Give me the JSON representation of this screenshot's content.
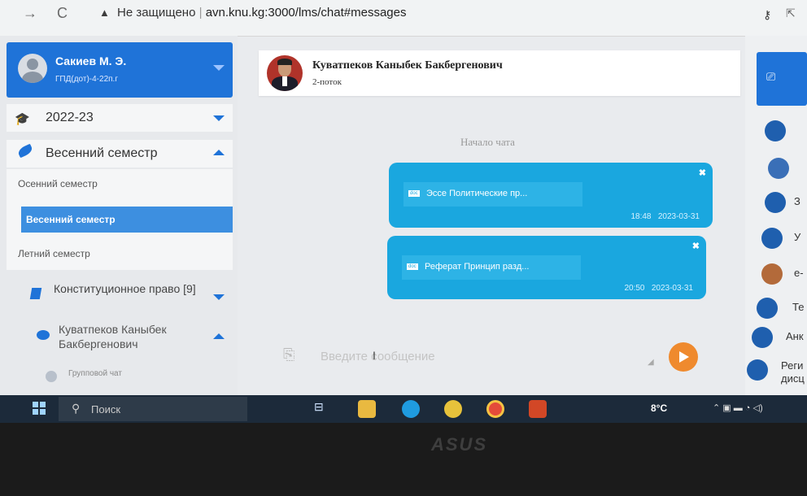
{
  "browser": {
    "security_label": "Не защищено",
    "separator": "|",
    "url": "avn.knu.kg:3000/lms/chat#messages"
  },
  "user": {
    "name": "Сакиев М. Э.",
    "group": "ГПД(дот)-4-22п.г"
  },
  "academic_year": "2022-23",
  "semester": {
    "selected": "Весенний семестр",
    "options": [
      "Осенний семестр",
      "Весенний семестр",
      "Летний семестр"
    ]
  },
  "course": {
    "label": "Конституционное право [9]"
  },
  "chat_contact": {
    "label": "Куватпеков Каныбек Бакбергенович"
  },
  "group_chat": {
    "label": "Групповой чат"
  },
  "chat": {
    "header_name": "Куватпеков Каныбек Бакбергенович",
    "header_stream": "2-поток",
    "start_label": "Начало чата",
    "messages": [
      {
        "file_type": "doc",
        "file_name": "Эссе Политические пр...",
        "time": "18:48",
        "date": "2023-03-31"
      },
      {
        "file_type": "doc",
        "file_name": "Реферат Принцип разд...",
        "time": "20:50",
        "date": "2023-03-31"
      }
    ],
    "input_placeholder": "Введите сообщение"
  },
  "right_panel": {
    "items": [
      {
        "icon": "calendar-icon",
        "text": ""
      },
      {
        "icon": "teacher-icon",
        "text": ""
      },
      {
        "icon": "notebook-icon",
        "text": "З"
      },
      {
        "icon": "book-icon",
        "text": "У"
      },
      {
        "icon": "books-icon",
        "text": "е-"
      },
      {
        "icon": "test-icon",
        "text": "Те"
      },
      {
        "icon": "survey-icon",
        "text": "Анк"
      },
      {
        "icon": "register-icon",
        "text": "Реги дисц"
      }
    ]
  },
  "taskbar": {
    "search_label": "Поиск",
    "weather": "8°C"
  },
  "bezel": {
    "brand": "ASUS"
  },
  "colors": {
    "primary": "#1f73d8",
    "message_bubble": "#1aa7df",
    "send_button": "#ef8a2e",
    "active_semester": "#3d8fe0"
  }
}
